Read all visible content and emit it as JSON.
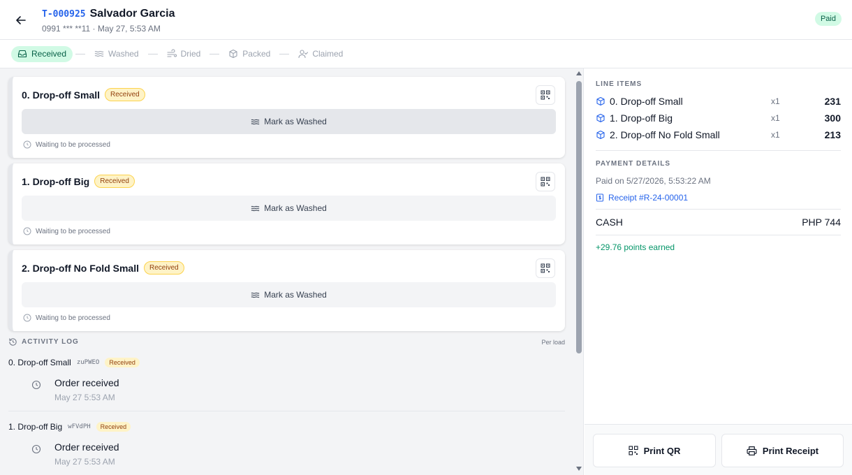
{
  "header": {
    "ticket_id": "T-000925",
    "customer_name": "Salvador Garcia",
    "subtitle": "0991 *** **11 · May 27, 5:53 AM",
    "status_badge": "Paid"
  },
  "steps": [
    {
      "label": "Received",
      "icon": "inbox-icon",
      "active": true
    },
    {
      "label": "Washed",
      "icon": "waves-icon",
      "active": false
    },
    {
      "label": "Dried",
      "icon": "wind-icon",
      "active": false
    },
    {
      "label": "Packed",
      "icon": "package-icon",
      "active": false
    },
    {
      "label": "Claimed",
      "icon": "user-check-icon",
      "active": false
    }
  ],
  "loads": [
    {
      "name": "0. Drop-off Small",
      "status": "Received",
      "action": "Mark as Washed",
      "note": "Waiting to be processed"
    },
    {
      "name": "1. Drop-off Big",
      "status": "Received",
      "action": "Mark as Washed",
      "note": "Waiting to be processed"
    },
    {
      "name": "2. Drop-off No Fold Small",
      "status": "Received",
      "action": "Mark as Washed",
      "note": "Waiting to be processed"
    }
  ],
  "activity": {
    "label": "ACTIVITY LOG",
    "per_label": "Per load",
    "groups": [
      {
        "load": "0. Drop-off Small",
        "code": "zuPWEO",
        "status": "Received",
        "entry": "Order received",
        "time": "May 27 5:53 AM"
      },
      {
        "load": "1. Drop-off Big",
        "code": "wFVdPH",
        "status": "Received",
        "entry": "Order received",
        "time": "May 27 5:53 AM"
      }
    ]
  },
  "line_items": {
    "label": "LINE ITEMS",
    "items": [
      {
        "name": "0. Drop-off Small",
        "qty": "x1",
        "price": "231"
      },
      {
        "name": "1. Drop-off Big",
        "qty": "x1",
        "price": "300"
      },
      {
        "name": "2. Drop-off No Fold Small",
        "qty": "x1",
        "price": "213"
      }
    ]
  },
  "payment": {
    "label": "PAYMENT DETAILS",
    "paid_on": "Paid on 5/27/2026, 5:53:22 AM",
    "receipt": "Receipt #R-24-00001",
    "method": "CASH",
    "amount": "PHP 744",
    "points": "+29.76 points earned"
  },
  "footer": {
    "print_qr": "Print QR",
    "print_receipt": "Print Receipt"
  },
  "colors": {
    "accent": "#2563eb",
    "success": "#059669",
    "badge_yellow": "#fef3c7"
  }
}
